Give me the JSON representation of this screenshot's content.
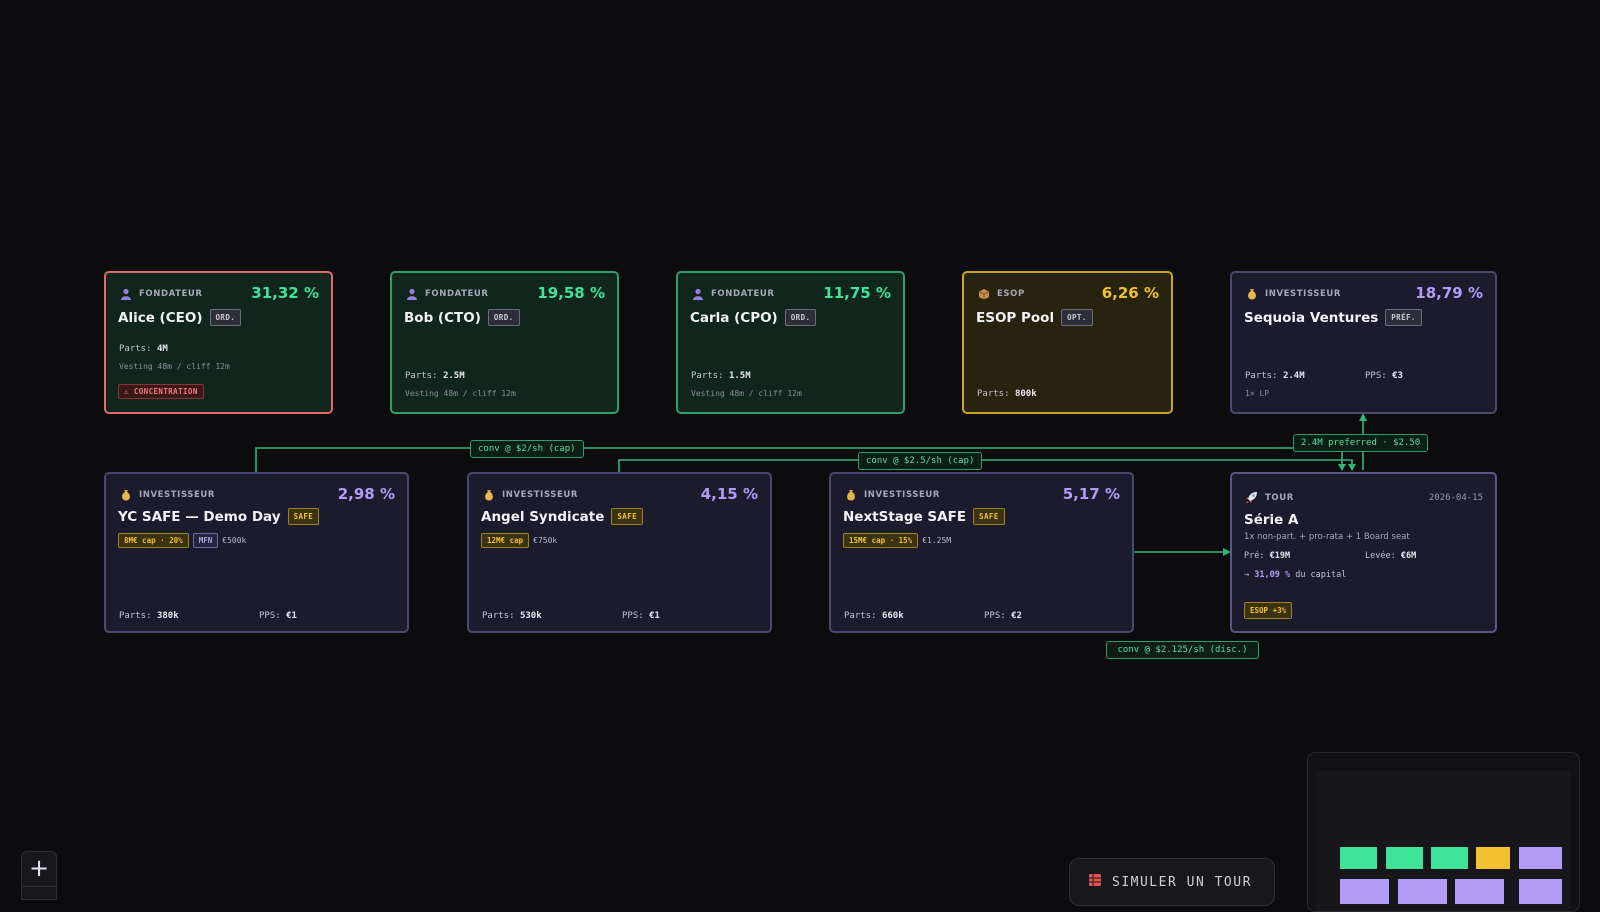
{
  "cards_top": [
    {
      "role": "FONDATEUR",
      "pct": "31,32 %",
      "name": "Alice (CEO)",
      "tag": "ORD.",
      "parts_label": "Parts:",
      "parts": "4M",
      "vesting": "Vesting 48m / cliff 12m",
      "warning": "⚠ CONCENTRATION"
    },
    {
      "role": "FONDATEUR",
      "pct": "19,58 %",
      "name": "Bob (CTO)",
      "tag": "ORD.",
      "parts_label": "Parts:",
      "parts": "2.5M",
      "vesting": "Vesting 48m / cliff 12m"
    },
    {
      "role": "FONDATEUR",
      "pct": "11,75 %",
      "name": "Carla (CPO)",
      "tag": "ORD.",
      "parts_label": "Parts:",
      "parts": "1.5M",
      "vesting": "Vesting 48m / cliff 12m"
    },
    {
      "role": "ESOP",
      "pct": "6,26 %",
      "name": "ESOP Pool",
      "tag": "OPT.",
      "parts_label": "Parts:",
      "parts": "800k"
    },
    {
      "role": "INVESTISSEUR",
      "pct": "18,79 %",
      "name": "Sequoia Ventures",
      "tag": "PRÉF.",
      "parts_label": "Parts:",
      "parts": "2.4M",
      "pps_label": "PPS:",
      "pps": "€3",
      "lp": "1× LP"
    }
  ],
  "cards_bottom": [
    {
      "role": "INVESTISSEUR",
      "pct": "2,98 %",
      "name": "YC SAFE — Demo Day",
      "tag": "SAFE",
      "chip1": "8M€ cap · 20%",
      "chip2": "MFN",
      "amount": "€500k",
      "parts_label": "Parts:",
      "parts": "380k",
      "pps_label": "PPS:",
      "pps": "€1"
    },
    {
      "role": "INVESTISSEUR",
      "pct": "4,15 %",
      "name": "Angel Syndicate",
      "tag": "SAFE",
      "chip1": "12M€ cap",
      "amount": "€750k",
      "parts_label": "Parts:",
      "parts": "530k",
      "pps_label": "PPS:",
      "pps": "€1"
    },
    {
      "role": "INVESTISSEUR",
      "pct": "5,17 %",
      "name": "NextStage SAFE",
      "tag": "SAFE",
      "chip1": "15M€ cap · 15%",
      "amount": "€1.25M",
      "parts_label": "Parts:",
      "parts": "660k",
      "pps_label": "PPS:",
      "pps": "€2"
    }
  ],
  "round": {
    "role": "TOUR",
    "date": "2026-04-15",
    "title": "Série A",
    "desc": "1x non-part. + pro-rata + 1 Board seat",
    "pre_label": "Pré:",
    "pre": "€19M",
    "raise_label": "Levée:",
    "raise": "€6M",
    "arrow": "→",
    "capital_pct": "31,09 %",
    "capital_suffix": "du capital",
    "esop_chip": "ESOP +3%"
  },
  "edge_labels": {
    "yc": "conv @ $2/sh (cap)",
    "angel": "conv @ $2.5/sh (cap)",
    "pref": "2.4M preferred · $2.50",
    "next": "conv @ $2.125/sh (disc.)"
  },
  "controls": {
    "zoom_in": "+",
    "simulate": "SIMULER UN TOUR"
  },
  "icons": {
    "founder": "person-icon",
    "esop": "box-icon",
    "investor": "money-bag-icon",
    "round": "rocket-icon"
  },
  "colors": {
    "green": "#3fe39a",
    "yellow": "#f2c230",
    "purple": "#b39cf6",
    "edge": "#2fb67a"
  }
}
